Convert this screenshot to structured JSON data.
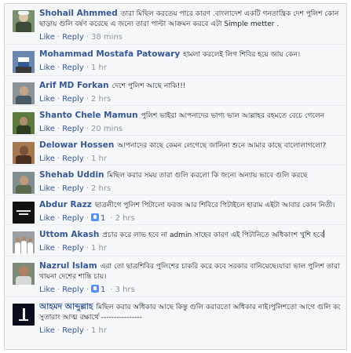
{
  "labels": {
    "like": "Like",
    "reply": "Reply",
    "dot": "·"
  },
  "comments": [
    {
      "name": "Shohail Ahmmed",
      "text": "তারা মিছিল করতেয় পারে কারণ .বাংলাদেশ একটি গনতান্ত্রিক দেশ পুলিশ কোন কারন",
      "text2": "ছাড়ায় গুলি বর্ষণ করেছে এ জন্যে তারা পাল্টা আক্রমন করবে এটা Simple metter .",
      "likes": "",
      "time": "38 mins"
    },
    {
      "name": "Mohammad Mostafa Patowary",
      "text": "হামলা করলেই লিগ শিবির হয়ে জায় কেন।",
      "text2": "",
      "likes": "",
      "time": "1 hr"
    },
    {
      "name": "Arif MD Forkan",
      "text": "দেশে পুলিশ আছে নাকি!!!",
      "text2": "",
      "likes": "",
      "time": "2 hrs"
    },
    {
      "name": "Shanto Chele Mamun",
      "text": "পুলিশ ভাইরা আপনাদের ভাগ্য ভাল আল্লাহর রহমতে বেচে গেলেন",
      "text2": "",
      "likes": "",
      "time": "20 mins"
    },
    {
      "name": "Delowar Hossen",
      "text": "আপনাদের কাছে কেমন লেগেছে জানিনা শুনে আমার কাছে বালোলাগলো?",
      "text2": "",
      "likes": "",
      "time": "1 hr"
    },
    {
      "name": "Shehab Uddin",
      "text": "মিছিল করার সময় তারা গুলি করলো কি জন্যে অন্যায় ভাবে গুলি করছে",
      "text2": "",
      "likes": "",
      "time": "2 hrs"
    },
    {
      "name": "Abdur Razz",
      "text": "ছাত্রলীগে পুলিশ পিটালো ফরজ আর শিবিরে পিটাইলে হারাম এইটা আবার কোন নিতী।",
      "text2": "",
      "likes": "1",
      "time": "2 hrs"
    },
    {
      "name": "Uttom Akash",
      "text": "প্রচার করে লাভ হবে না admin সাহেব কারণ এই পিটানিতে অধিকাংশ খুশি হবে",
      "text2": "",
      "likes": "",
      "time": "1 hr",
      "cursor": true
    },
    {
      "name": "Nazrul Islam",
      "text": "এরা তো ছাত্রশিবির পুলিশের চাকরি করে কবে সরকার বানিয়েছে।যারা ভাল পুলিশ তারা মার",
      "text2": "খায়না দেশের শান্তি চায়।",
      "likes": "1",
      "time": "3 hrs"
    },
    {
      "name": "আহমদ আব্দুল্লাহ",
      "text": "মিছিল করার অধিকার আছে কিন্তু গুলি করারতো অধিকার নাই।পুলিশতো আগে গুলি করেছে।",
      "text2": "সুতারাং আত্ম রক্ষার্থে ----------------",
      "likes": "",
      "time": "1 hr"
    }
  ]
}
